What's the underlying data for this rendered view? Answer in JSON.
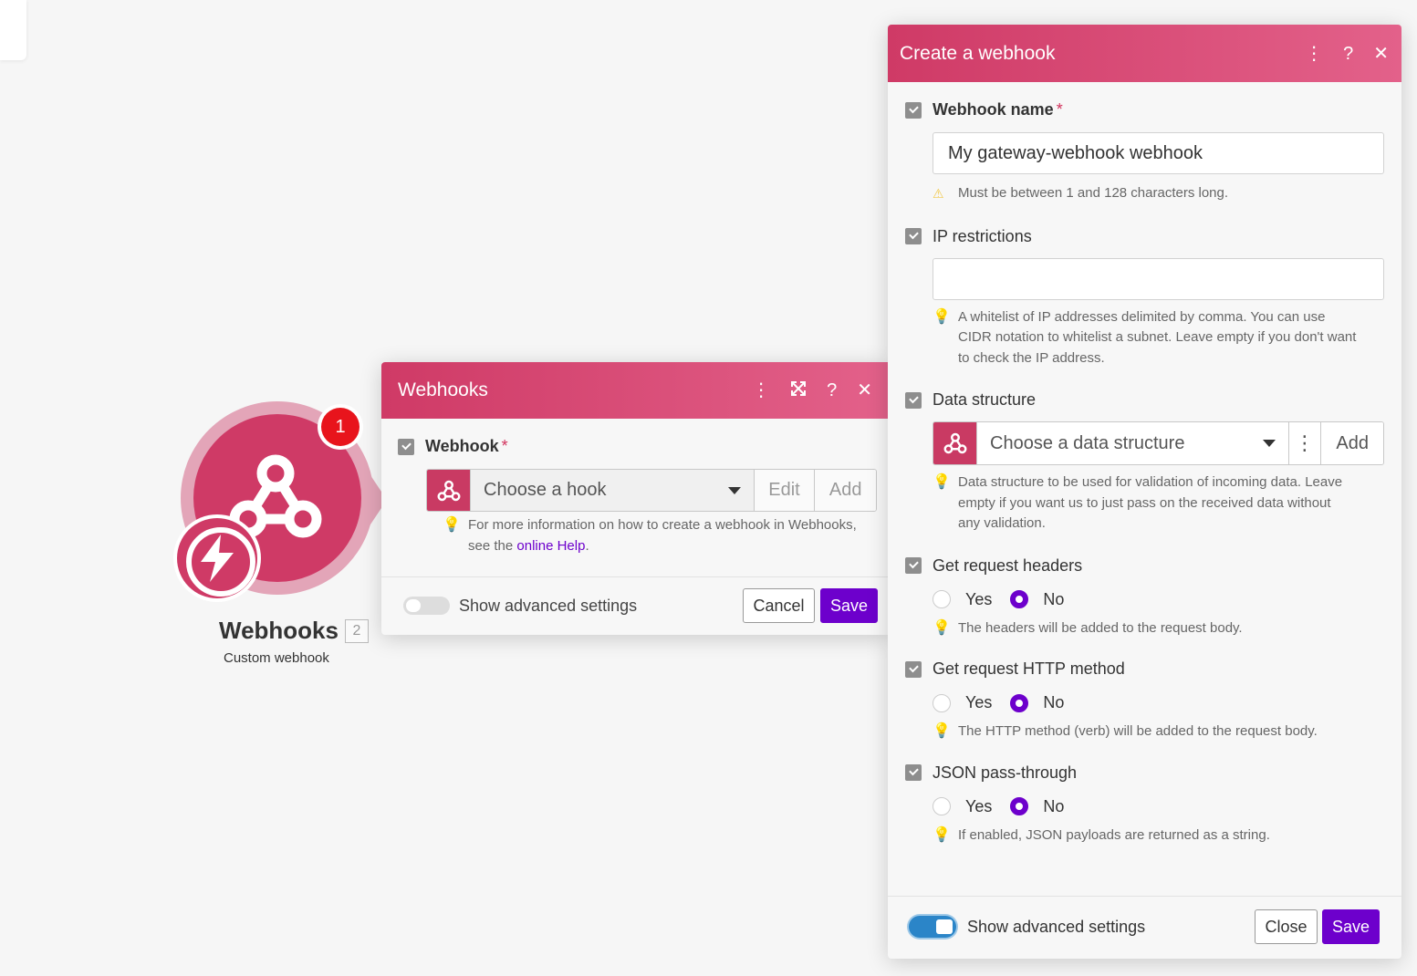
{
  "module": {
    "title": "Webhooks",
    "id": "2",
    "subtitle": "Custom webhook",
    "badge": "1",
    "icon": "webhook-icon",
    "trigger_icon": "lightning-icon",
    "color": "#cf3a66"
  },
  "webhooks_panel": {
    "title": "Webhooks",
    "field_label": "Webhook",
    "required_mark": "*",
    "select_placeholder": "Choose a hook",
    "edit_label": "Edit",
    "add_label": "Add",
    "help_text": "For more information on how to create a webhook in Webhooks,",
    "help_text_2_pre": "see the",
    "help_link": "online Help",
    "help_text_2_post": ".",
    "advanced_label": "Show advanced settings",
    "advanced_on": false,
    "cancel_label": "Cancel",
    "save_label": "Save"
  },
  "create_panel": {
    "title": "Create a webhook",
    "name_label": "Webhook name",
    "required_mark": "*",
    "name_value": "My gateway-webhook webhook",
    "name_hint": "Must be between 1 and 128 characters long.",
    "ip_label": "IP restrictions",
    "ip_value": "",
    "ip_hint_1": "A whitelist of IP addresses delimited by comma. You can use",
    "ip_hint_2": "CIDR notation to whitelist a subnet. Leave empty if you don't want",
    "ip_hint_3": "to check the IP address.",
    "ds_label": "Data structure",
    "ds_placeholder": "Choose a data structure",
    "ds_add_label": "Add",
    "ds_hint_1": "Data structure to be used for validation of incoming data. Leave",
    "ds_hint_2": "empty if you want us to just pass on the received data without",
    "ds_hint_3": "any validation.",
    "headers_label": "Get request headers",
    "headers_hint": "The headers will be added to the request body.",
    "method_label": "Get request HTTP method",
    "method_hint": "The HTTP method (verb) will be added to the request body.",
    "json_label": "JSON pass-through",
    "json_hint": "If enabled, JSON payloads are returned as a string.",
    "yes_label": "Yes",
    "no_label": "No",
    "headers_selected": "No",
    "method_selected": "No",
    "json_selected": "No",
    "advanced_label": "Show advanced settings",
    "advanced_on": true,
    "close_label": "Close",
    "save_label": "Save"
  },
  "colors": {
    "brand": "#cf3a66",
    "primary_button": "#6d00cc",
    "badge": "#e8141c",
    "toggle_on": "#2b85c8"
  }
}
